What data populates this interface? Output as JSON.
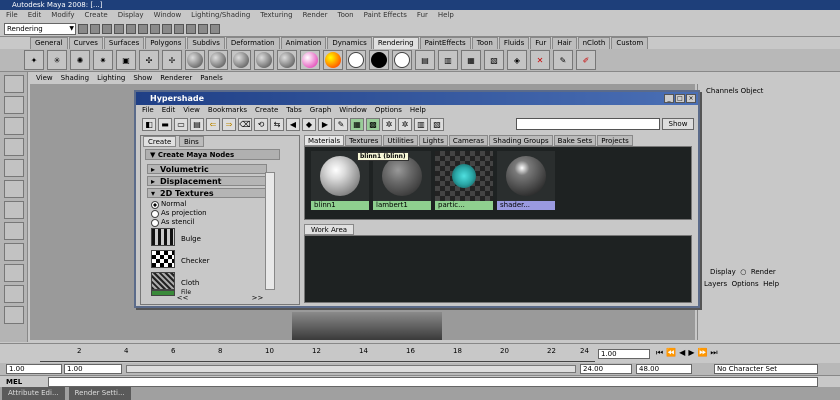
{
  "maya": {
    "title": "Autodesk Maya 2008: [...]",
    "menus": [
      "File",
      "Edit",
      "Modify",
      "Create",
      "Display",
      "Window",
      "Lighting/Shading",
      "Texturing",
      "Render",
      "Toon",
      "Paint Effects",
      "Fur",
      "Help"
    ],
    "mode": "Rendering",
    "shelf_tabs": [
      "General",
      "Curves",
      "Surfaces",
      "Polygons",
      "Subdivs",
      "Deformation",
      "Animation",
      "Dynamics",
      "Rendering",
      "PaintEffects",
      "Toon",
      "Fluids",
      "Fur",
      "Hair",
      "nCloth",
      "Custom"
    ],
    "active_shelf_tab": "Rendering",
    "panel_menu": [
      "View",
      "Shading",
      "Lighting",
      "Show",
      "Renderer",
      "Panels"
    ],
    "channel_box_header": [
      "Channels",
      "Object"
    ],
    "channel_box_footer": [
      "Display",
      "Render",
      "Layers",
      "Options",
      "Help"
    ],
    "timeline_ticks": [
      "2",
      "4",
      "6",
      "8",
      "10",
      "12",
      "14",
      "16",
      "18",
      "20",
      "22",
      "24"
    ],
    "current_frame": "1.00",
    "range": {
      "start": "1.00",
      "start2": "1.00",
      "end": "24.00",
      "end2": "48.00",
      "character_set": "No Character Set"
    },
    "cmd_label": "MEL",
    "taskbar": [
      "Attribute Edi...",
      "Render Setti..."
    ]
  },
  "hypershade": {
    "title": "Hypershade",
    "menus": [
      "File",
      "Edit",
      "View",
      "Bookmarks",
      "Create",
      "Tabs",
      "Graph",
      "Window",
      "Options",
      "Help"
    ],
    "show_label": "Show",
    "left_tabs": [
      "Create",
      "Bins"
    ],
    "create_header": "Create Maya Nodes",
    "categories": [
      "Volumetric",
      "Displacement",
      "2D Textures"
    ],
    "projection_options": [
      {
        "label": "Normal",
        "selected": true
      },
      {
        "label": "As projection",
        "selected": false
      },
      {
        "label": "As stencil",
        "selected": false
      }
    ],
    "textures": [
      "Bulge",
      "Checker",
      "Cloth",
      "File"
    ],
    "nav": [
      "<<",
      ">>"
    ],
    "material_tabs": [
      "Materials",
      "Textures",
      "Utilities",
      "Lights",
      "Cameras",
      "Shading Groups",
      "Bake Sets",
      "Projects"
    ],
    "active_material_tab": "Materials",
    "swatches": [
      {
        "label": "blinn1",
        "ball": "#dcdcdc",
        "label_bg": "#8fd08f"
      },
      {
        "label": "lambert1",
        "ball": "#6a6a6a",
        "label_bg": "#8fd08f"
      },
      {
        "label": "partic...",
        "ball": "#2aa6a6",
        "label_bg": "#8fd08f"
      },
      {
        "label": "shader...",
        "ball": "#7a7a7a",
        "label_bg": "#9a9ae0"
      }
    ],
    "tooltip": "blinn1 (blinn)",
    "work_area_tab": "Work Area"
  }
}
